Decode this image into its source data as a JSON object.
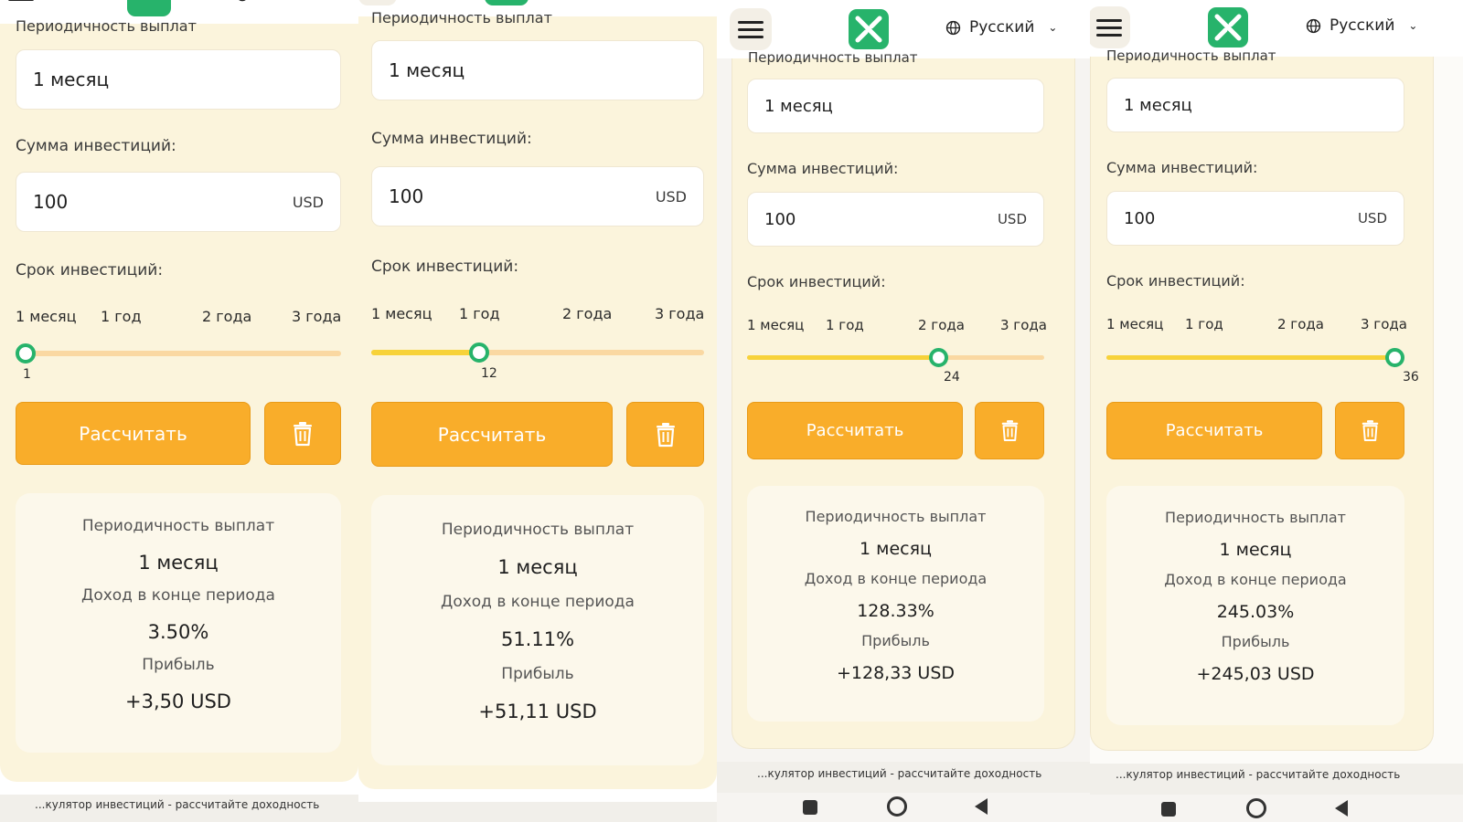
{
  "colors": {
    "accent": "#f9ad2a",
    "slider_thumb": "#27b36b",
    "slider_fill": "#f7d23a",
    "slider_track": "#fad8a2",
    "logo": "#27b36b"
  },
  "icons": {
    "menu": "hamburger-menu-icon",
    "logo": "brand-logo-icon",
    "language": "globe-icon",
    "dropdown": "chevron-down-icon",
    "delete": "trash-icon"
  },
  "panels": [
    {
      "language": "",
      "payout_label_cut": "Периодичность выплат",
      "payout_value": "1 месяц",
      "amount_label": "Сумма инвестиций:",
      "amount_value": "100",
      "currency": "USD",
      "term_label": "Срок инвестиций:",
      "ticks": [
        "1 месяц",
        "1 год",
        "2 года",
        "3 года"
      ],
      "slider_value": 1,
      "slider_fraction": 0.0,
      "calc_label": "Рассчитать",
      "result": {
        "payout_label": "Периодичность выплат",
        "payout_value": "1 месяц",
        "income_label": "Доход в конце периода",
        "income_value": "3.50%",
        "profit_label": "Прибыль",
        "profit_value": "+3,50 USD"
      },
      "footer_text": "...кулятор инвестиций - рассчитайте доходность"
    },
    {
      "language": "",
      "payout_label_cut": "Периодичность выплат",
      "payout_value": "1 месяц",
      "amount_label": "Сумма инвестиций:",
      "amount_value": "100",
      "currency": "USD",
      "term_label": "Срок инвестиций:",
      "ticks": [
        "1 месяц",
        "1 год",
        "2 года",
        "3 года"
      ],
      "slider_value": 12,
      "slider_fraction": 0.3333,
      "calc_label": "Рассчитать",
      "result": {
        "payout_label": "Периодичность выплат",
        "payout_value": "1 месяц",
        "income_label": "Доход в конце периода",
        "income_value": "51.11%",
        "profit_label": "Прибыль",
        "profit_value": "+51,11 USD"
      },
      "footer_text": ""
    },
    {
      "language": "Русский",
      "payout_label_cut": "Периодичность выплат",
      "payout_value": "1 месяц",
      "amount_label": "Сумма инвестиций:",
      "amount_value": "100",
      "currency": "USD",
      "term_label": "Срок инвестиций:",
      "ticks": [
        "1 месяц",
        "1 год",
        "2 года",
        "3 года"
      ],
      "slider_value": 24,
      "slider_fraction": 0.6667,
      "calc_label": "Рассчитать",
      "result": {
        "payout_label": "Периодичность выплат",
        "payout_value": "1 месяц",
        "income_label": "Доход в конце периода",
        "income_value": "128.33%",
        "profit_label": "Прибыль",
        "profit_value": "+128,33 USD"
      },
      "footer_text": "...кулятор инвестиций - рассчитайте доходность"
    },
    {
      "language": "Русский",
      "payout_label_cut": "Периодичность выплат",
      "payout_value": "1 месяц",
      "amount_label": "Сумма инвестиций:",
      "amount_value": "100",
      "currency": "USD",
      "term_label": "Срок инвестиций:",
      "ticks": [
        "1 месяц",
        "1 год",
        "2 года",
        "3 года"
      ],
      "slider_value": 36,
      "slider_fraction": 1.0,
      "calc_label": "Рассчитать",
      "result": {
        "payout_label": "Периодичность выплат",
        "payout_value": "1 месяц",
        "income_label": "Доход в конце периода",
        "income_value": "245.03%",
        "profit_label": "Прибыль",
        "profit_value": "+245,03 USD"
      },
      "footer_text": "...кулятор инвестиций - рассчитайте доходность"
    }
  ]
}
